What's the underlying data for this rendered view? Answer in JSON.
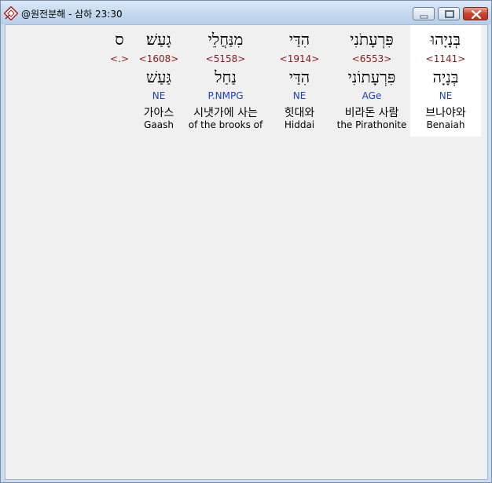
{
  "window": {
    "title": "@원전분해 - 삼하 23:30",
    "icon": "bible-app-icon",
    "buttons": [
      "minimize",
      "maximize",
      "close"
    ]
  },
  "words": [
    {
      "hebrew": "בְּנָיָהוּ",
      "strong": "<1141>",
      "lemma": "בְּנָיָה",
      "parse": "NE",
      "korean": "브나야와",
      "english": "Benaiah",
      "selected": true
    },
    {
      "hebrew": "פִּרְעָתֹנִי",
      "strong": "<6553>",
      "lemma": "פִּרְעָתוֹנִי",
      "parse": "AGe",
      "korean": "비라돈 사람",
      "english": "the Pirathonite",
      "selected": false
    },
    {
      "hebrew": "הִדַּי",
      "strong": "<1914>",
      "lemma": "הִדַּי",
      "parse": "NE",
      "korean": "힛대와",
      "english": "Hiddai",
      "selected": false
    },
    {
      "hebrew": "מִנַּחֲלֵי",
      "strong": "<5158>",
      "lemma": "נַחַל",
      "parse": "P.NMPG",
      "korean": "시냇가에 사는",
      "english": "of the brooks of",
      "selected": false
    },
    {
      "hebrew": "גָעַשׁ׃",
      "strong": "<1608>",
      "lemma": "גַּעַשׁ",
      "parse": "NE",
      "korean": "가아스",
      "english": "Gaash",
      "selected": false
    },
    {
      "hebrew": "ס",
      "strong": "<.>",
      "lemma": "",
      "parse": "",
      "korean": "",
      "english": "",
      "selected": false
    }
  ],
  "colors": {
    "strong": "#8b1a1a",
    "parse": "#1f3fbf",
    "selected_bg": "#ffffff",
    "client_bg": "#f0f0f0"
  }
}
